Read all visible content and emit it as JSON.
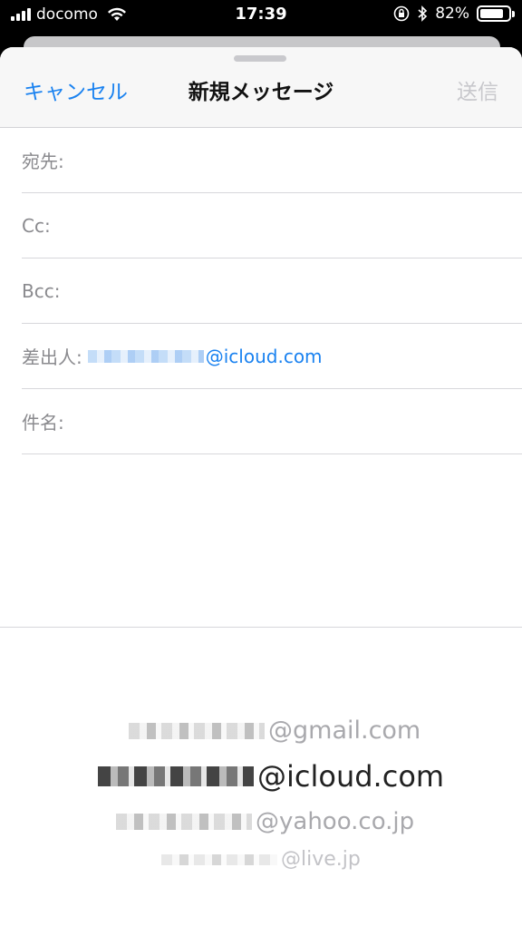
{
  "status_bar": {
    "carrier": "docomo",
    "time": "17:39",
    "battery": "82%",
    "battery_level": 0.82
  },
  "compose": {
    "cancel_label": "キャンセル",
    "title": "新規メッセージ",
    "send_label": "送信",
    "fields": {
      "to_label": "宛先:",
      "cc_label": "Cc:",
      "bcc_label": "Bcc:",
      "from_label": "差出人:",
      "from_domain": "@icloud.com",
      "subject_label": "件名:"
    }
  },
  "suggestions": [
    {
      "domain": "@gmail.com"
    },
    {
      "domain": "@icloud.com"
    },
    {
      "domain": "@yahoo.co.jp"
    },
    {
      "domain": "@live.jp"
    }
  ],
  "colors": {
    "accent": "#1a82f0",
    "disabled": "#c8c8cc",
    "label_gray": "#8a8a8e"
  }
}
